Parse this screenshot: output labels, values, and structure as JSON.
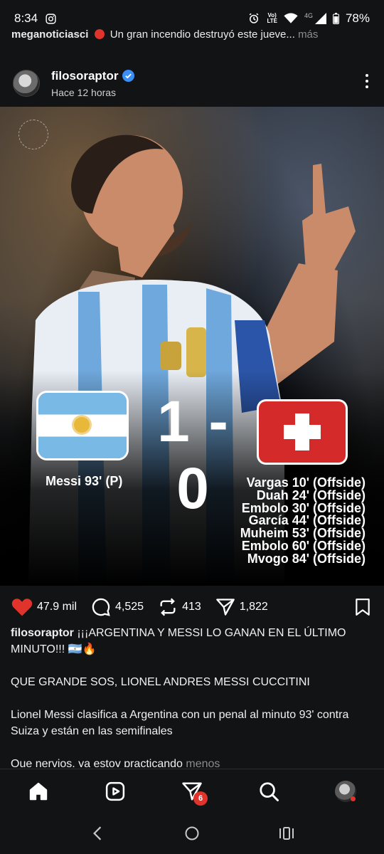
{
  "status_bar": {
    "time": "8:34",
    "volte_top": "Vo)",
    "volte_bottom": "LTE",
    "network": "4G",
    "battery": "78%"
  },
  "prev_post": {
    "username": "meganoticiasci",
    "text": "Un gran incendio destruyó este jueve...",
    "more": "más"
  },
  "post": {
    "username": "filosoraptor",
    "time": "Hace 12 horas",
    "image": {
      "score": "1 - 0",
      "home_scorer": "Messi 93' (P)",
      "away_scorers": [
        "Vargas 10' (Offside)",
        "Duah 24' (Offside)",
        "Embolo 30' (Offside)",
        "García 44' (Offside)",
        "Muheim 53' (Offside)",
        "Embolo 60' (Offside)",
        "Mvogo 84' (Offside)"
      ]
    },
    "stats": {
      "likes": "47.9 mil",
      "comments": "4,525",
      "reposts": "413",
      "shares": "1,822"
    },
    "caption": {
      "username": "filosoraptor",
      "line1": "¡¡¡ARGENTINA Y MESSI LO GANAN EN EL ÚLTIMO MINUTO!!! 🇦🇷🔥",
      "para2": "QUE GRANDE SOS, LIONEL ANDRES MESSI CUCCITINI",
      "para3": "Lionel Messi clasifica a Argentina con un penal al minuto 93' contra Suiza y están en las semifinales",
      "para4": "Que nervios, ya estoy practicando",
      "less": "menos"
    }
  },
  "bottom_nav": {
    "notification_count": "6"
  },
  "colors": {
    "background": "#111315",
    "like_red": "#e0332b",
    "verified_blue": "#3a8ef6",
    "muted_text": "#8a8d91"
  }
}
